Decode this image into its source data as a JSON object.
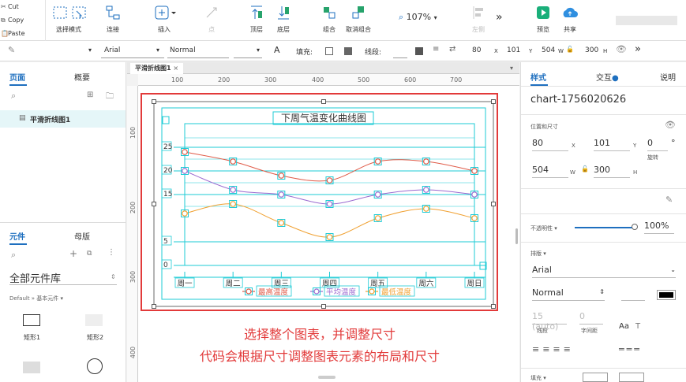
{
  "clipboard": {
    "cut": "Cut",
    "copy": "Copy",
    "paste": "Paste"
  },
  "toolbar": {
    "select_mode": "选择模式",
    "connect": "连接",
    "insert": "插入",
    "point": "点",
    "top": "顶层",
    "bottom": "底层",
    "group": "组合",
    "ungroup": "取消组合",
    "zoom": "107%",
    "left": "左侧",
    "preview": "预览",
    "share": "共享"
  },
  "format_bar": {
    "font": "Arial",
    "weight": "Normal",
    "fill_label": "填充:",
    "stroke_label": "线段:",
    "x": "80",
    "x_label": "X",
    "y": "101",
    "y_label": "Y",
    "w": "504",
    "w_label": "W",
    "h": "300",
    "h_label": "H"
  },
  "left_panel": {
    "tab_pages": "页面",
    "tab_outline": "概要",
    "page_item": "平滑折线图1",
    "tab_widgets": "元件",
    "tab_masters": "母版",
    "library": "全部元件库",
    "library_path": "Default » 基本元件",
    "widget1": "矩形1",
    "widget2": "矩形2"
  },
  "canvas": {
    "page_tab": "平滑折线图1",
    "ruler_h": [
      "100",
      "200",
      "300",
      "400",
      "500",
      "600",
      "700"
    ],
    "ruler_v": [
      "100",
      "200",
      "300",
      "400"
    ]
  },
  "annotation": {
    "line1": "选择整个图表，并调整尺寸",
    "line2": "代码会根据尺寸调整图表元素的布局和尺寸"
  },
  "right_panel": {
    "tab_style": "样式",
    "tab_interact": "交互",
    "tab_notes": "说明",
    "element_name": "chart-1756020626",
    "pos_size_label": "位置和尺寸",
    "x": "80",
    "x_label": "X",
    "y": "101",
    "y_label": "Y",
    "rot": "0",
    "rot_unit": "°",
    "rot_label": "旋转",
    "w": "504",
    "w_label": "W",
    "h": "300",
    "h_label": "H",
    "opacity_label": "不透明性",
    "opacity": "100%",
    "typography_label": "排版",
    "font": "Arial",
    "weight": "Normal",
    "size": "15 (auto)",
    "size_label": "线段",
    "spacing": "0",
    "spacing_label": "字间距",
    "fill_label": "填充"
  },
  "chart_data": {
    "type": "line",
    "title": "下周气温变化曲线图",
    "categories": [
      "周一",
      "周二",
      "周三",
      "周四",
      "周五",
      "周六",
      "周日"
    ],
    "series": [
      {
        "name": "最高温度",
        "color": "#e05a47",
        "values": [
          24,
          22,
          19,
          18,
          22,
          22,
          20
        ]
      },
      {
        "name": "平均温度",
        "color": "#9b6ad0",
        "values": [
          20,
          16,
          15,
          13,
          15,
          16,
          15
        ]
      },
      {
        "name": "最低温度",
        "color": "#f0a030",
        "values": [
          11,
          13,
          9,
          6,
          10,
          12,
          10
        ]
      }
    ],
    "yticks": [
      "25",
      "20",
      "15",
      "5",
      "0"
    ],
    "ylim": [
      0,
      30
    ],
    "accent": "#1ecbd6"
  }
}
